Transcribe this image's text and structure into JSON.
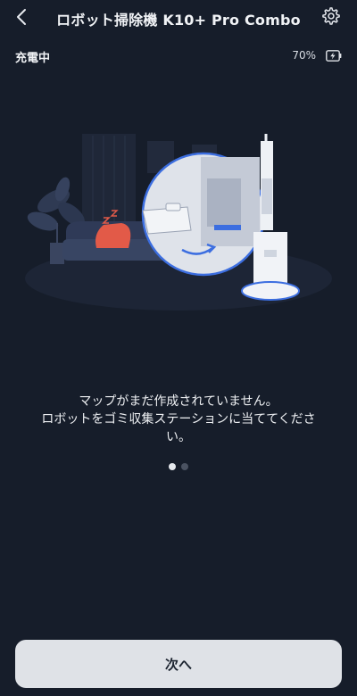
{
  "header": {
    "title": "ロボット掃除機 K10+ Pro Combo"
  },
  "status": {
    "charging_label": "充電中",
    "battery_percent": "70%"
  },
  "message": {
    "line1": "マップがまだ作成されていません。",
    "line2": "ロボットをゴミ収集ステーションに当ててくださ",
    "line3": "い。"
  },
  "pager": {
    "total": 2,
    "active": 0
  },
  "actions": {
    "next_label": "次へ"
  },
  "icons": {
    "back": "chevron-left-icon",
    "settings": "gear-icon",
    "battery": "battery-charging-icon"
  }
}
